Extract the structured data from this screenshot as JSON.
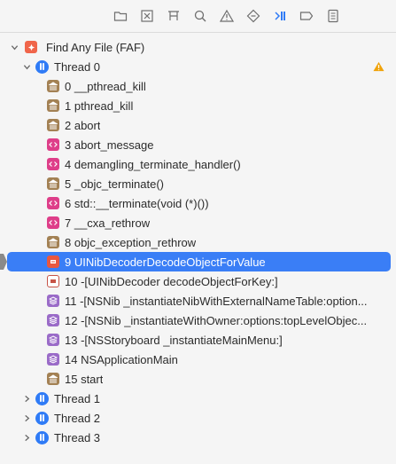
{
  "toolbar": {
    "icons": [
      "folder-icon",
      "close-square-icon",
      "hierarchy-icon",
      "search-icon",
      "warning-icon",
      "diamond-icon",
      "debug-navigator-icon",
      "tag-icon",
      "report-icon"
    ],
    "accent": "#2f7bf6"
  },
  "tree": {
    "root": {
      "label": "Find Any File (FAF)",
      "icon": "app-icon"
    },
    "thread0": {
      "label": "Thread 0",
      "has_warning": true
    },
    "frames": [
      {
        "label": "0 __pthread_kill",
        "icon": "building"
      },
      {
        "label": "1 pthread_kill",
        "icon": "building"
      },
      {
        "label": "2 abort",
        "icon": "building"
      },
      {
        "label": "3 abort_message",
        "icon": "code"
      },
      {
        "label": "4 demangling_terminate_handler()",
        "icon": "code"
      },
      {
        "label": "5 _objc_terminate()",
        "icon": "building"
      },
      {
        "label": "6 std::__terminate(void (*)())",
        "icon": "code"
      },
      {
        "label": "7 __cxa_rethrow",
        "icon": "code"
      },
      {
        "label": "8 objc_exception_rethrow",
        "icon": "building"
      },
      {
        "label": "9 UINibDecoderDecodeObjectForValue",
        "icon": "red",
        "selected": true
      },
      {
        "label": "10 -[UINibDecoder decodeObjectForKey:]",
        "icon": "outline"
      },
      {
        "label": "11 -[NSNib _instantiateNibWithExternalNameTable:option...",
        "icon": "stack"
      },
      {
        "label": "12 -[NSNib _instantiateWithOwner:options:topLevelObjec...",
        "icon": "stack"
      },
      {
        "label": "13 -[NSStoryboard _instantiateMainMenu:]",
        "icon": "stack"
      },
      {
        "label": "14 NSApplicationMain",
        "icon": "stack"
      },
      {
        "label": "15 start",
        "icon": "building"
      }
    ],
    "other_threads": [
      {
        "label": "Thread 1"
      },
      {
        "label": "Thread 2"
      },
      {
        "label": "Thread 3"
      }
    ]
  },
  "colors": {
    "selection": "#3a7ef6",
    "warning": "#f0a30a"
  }
}
